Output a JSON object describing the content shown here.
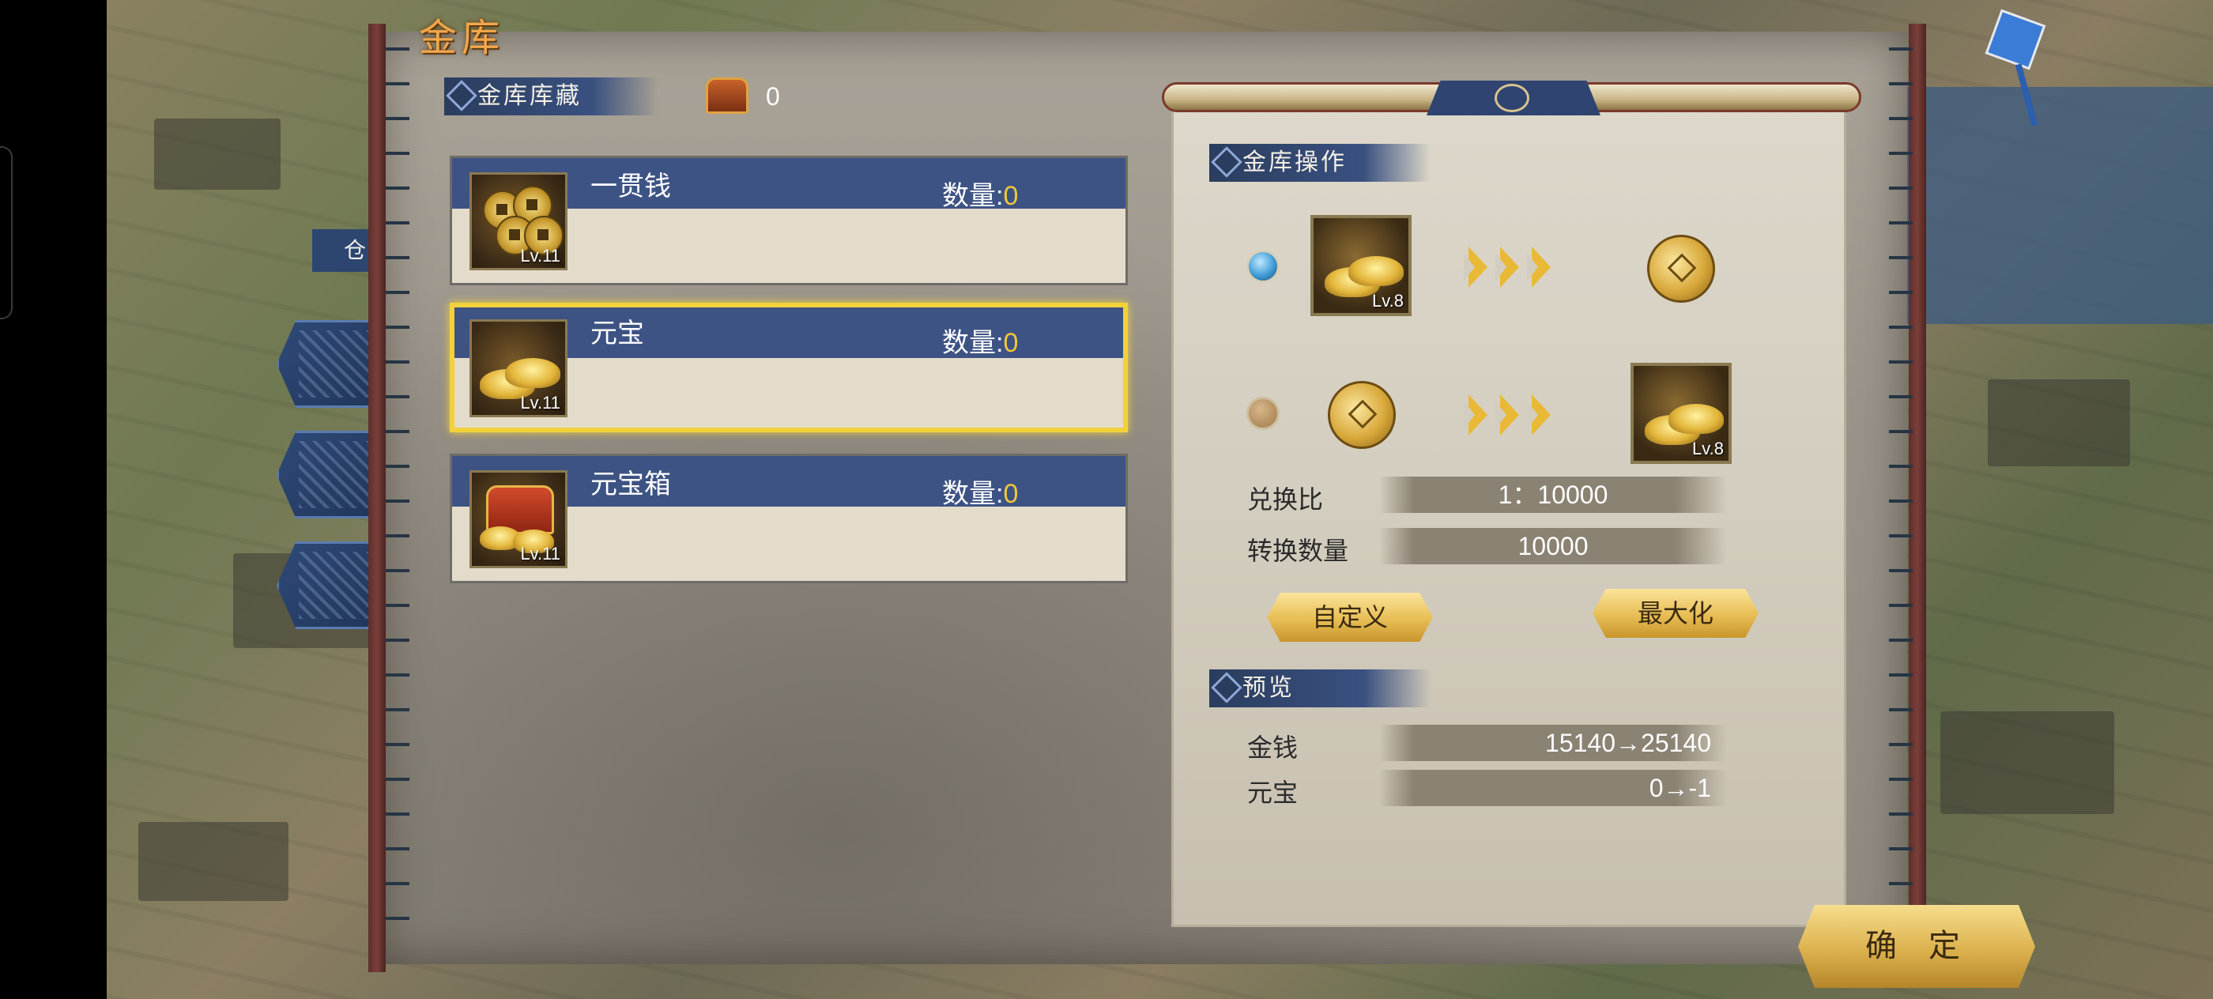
{
  "window": {
    "title": "金库",
    "side_tab_label": "仓"
  },
  "treasury": {
    "header": "金库库藏",
    "chest_count": "0",
    "items": [
      {
        "name": "一贯钱",
        "qty_label": "数量:",
        "qty_value": "0",
        "level": "Lv.11",
        "icon": "coin-string-icon"
      },
      {
        "name": "元宝",
        "qty_label": "数量:",
        "qty_value": "0",
        "level": "Lv.11",
        "icon": "gold-ingot-icon",
        "selected": true
      },
      {
        "name": "元宝箱",
        "qty_label": "数量:",
        "qty_value": "0",
        "level": "Lv.11",
        "icon": "ingot-chest-icon"
      }
    ]
  },
  "operations": {
    "header": "金库操作",
    "option1": {
      "from_level": "Lv.8",
      "selected": true
    },
    "option2": {
      "to_level": "Lv.8",
      "selected": false
    },
    "ratio_label": "兑换比",
    "ratio_value": "1：10000",
    "amount_label": "转换数量",
    "amount_value": "10000",
    "custom_button": "自定义",
    "max_button": "最大化"
  },
  "preview": {
    "header": "预览",
    "money_label": "金钱",
    "money_value": "15140→25140",
    "ingot_label": "元宝",
    "ingot_value": "0→-1"
  },
  "confirm_button": "确定",
  "colors": {
    "accent_gold": "#f2c53a",
    "header_blue": "#3d5384",
    "title_orange": "#f3a64a"
  }
}
